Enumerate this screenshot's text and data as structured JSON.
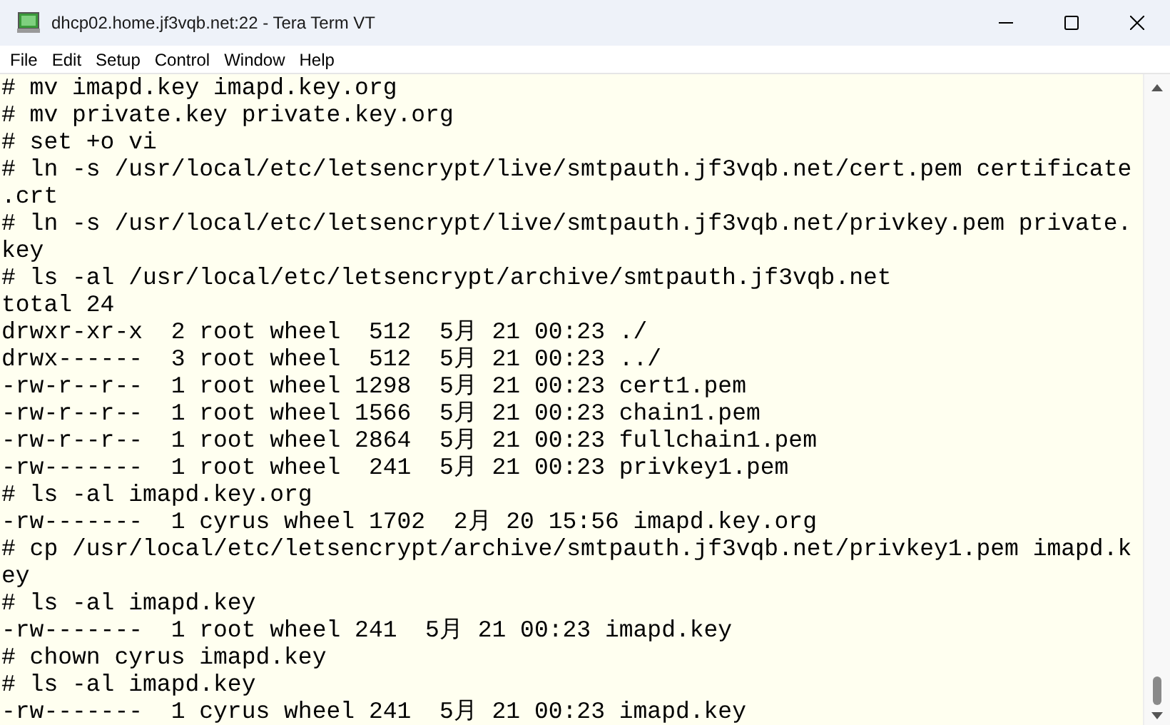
{
  "window": {
    "title": "dhcp02.home.jf3vqb.net:22 - Tera Term VT"
  },
  "menu": [
    "File",
    "Edit",
    "Setup",
    "Control",
    "Window",
    "Help"
  ],
  "terminal": {
    "lines": [
      "# mv imapd.key imapd.key.org",
      "# mv private.key private.key.org",
      "# set +o vi",
      "# ln -s /usr/local/etc/letsencrypt/live/smtpauth.jf3vqb.net/cert.pem certificate",
      ".crt",
      "# ln -s /usr/local/etc/letsencrypt/live/smtpauth.jf3vqb.net/privkey.pem private.",
      "key",
      "# ls -al /usr/local/etc/letsencrypt/archive/smtpauth.jf3vqb.net",
      "total 24",
      "drwxr-xr-x  2 root wheel  512  5月 21 00:23 ./",
      "drwx------  3 root wheel  512  5月 21 00:23 ../",
      "-rw-r--r--  1 root wheel 1298  5月 21 00:23 cert1.pem",
      "-rw-r--r--  1 root wheel 1566  5月 21 00:23 chain1.pem",
      "-rw-r--r--  1 root wheel 2864  5月 21 00:23 fullchain1.pem",
      "-rw-------  1 root wheel  241  5月 21 00:23 privkey1.pem",
      "# ls -al imapd.key.org",
      "-rw-------  1 cyrus wheel 1702  2月 20 15:56 imapd.key.org",
      "# cp /usr/local/etc/letsencrypt/archive/smtpauth.jf3vqb.net/privkey1.pem imapd.k",
      "ey",
      "# ls -al imapd.key",
      "-rw-------  1 root wheel 241  5月 21 00:23 imapd.key",
      "# chown cyrus imapd.key",
      "# ls -al imapd.key",
      "-rw-------  1 cyrus wheel 241  5月 21 00:23 imapd.key"
    ]
  }
}
